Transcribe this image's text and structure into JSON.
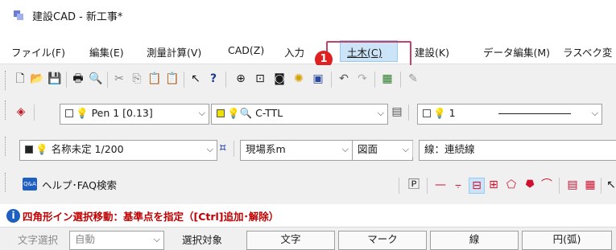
{
  "window": {
    "title": "建設CAD - 新工事*",
    "app_icon": "app-icon"
  },
  "menu": {
    "items": [
      {
        "label": "ファイル(F)"
      },
      {
        "label": "編集(E)"
      },
      {
        "label": "測量計算(V)"
      },
      {
        "label": "CAD(Z)"
      },
      {
        "label": "入力"
      },
      {
        "label": "土木(C)"
      },
      {
        "label": "建設(K)"
      },
      {
        "label": "データ編集(M)"
      },
      {
        "label": "ラスベク変"
      }
    ],
    "highlighted": "土木(C)",
    "callout_number": "1"
  },
  "toolbar_standard": {
    "icons": [
      "new-file-icon",
      "open-folder-icon",
      "save-icon",
      "print-icon",
      "print-preview-icon",
      "cut-icon",
      "copy-icon",
      "paste-icon",
      "paste-special-icon",
      "select-arrow-icon",
      "help-icon",
      "zoom-in-icon",
      "zoom-fit-icon",
      "zoom-window-icon",
      "redraw-icon",
      "zoom-prev-icon",
      "undo-icon",
      "redo-icon",
      "layer-icon",
      "properties-icon"
    ]
  },
  "toolbar_pen": {
    "pen_combo": "Pen 1 [0.13]",
    "layer_combo": "C-TTL",
    "linetype_combo": "1"
  },
  "toolbar_drawing": {
    "scale_combo": "名称未定 1/200",
    "coord_combo": "現場系m",
    "view_combo": "図面",
    "line_mode": "線：連続線"
  },
  "toolbar_help": {
    "faq_label": "ヘルプ･FAQ検索",
    "faq_icon_text": "Q&A"
  },
  "status": {
    "message": "四角形イン選択移動：基準点を指定（[Ctrl]追加･解除）"
  },
  "selection_row": {
    "text_select_label": "文字選択",
    "auto_value": "自動",
    "target_label": "選択対象",
    "buttons": [
      "文字",
      "マーク",
      "線",
      "円(弧)"
    ]
  },
  "colors": {
    "accent_highlight": "#cce4f7",
    "callout_red": "#e02020",
    "callout_border": "#c0446a",
    "status_text": "#c00000"
  }
}
